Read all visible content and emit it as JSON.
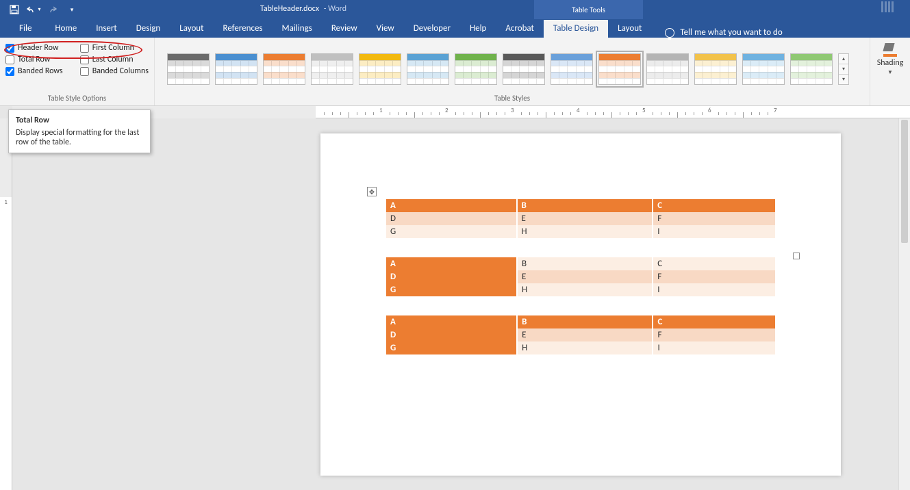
{
  "titlebar": {
    "doc_name": "TableHeader.docx",
    "app_suffix": "  -  Word",
    "table_tools_label": "Table Tools"
  },
  "tabs": {
    "file": "File",
    "home": "Home",
    "insert": "Insert",
    "design": "Design",
    "layout": "Layout",
    "references": "References",
    "mailings": "Mailings",
    "review": "Review",
    "view": "View",
    "developer": "Developer",
    "help": "Help",
    "acrobat": "Acrobat",
    "table_design": "Table Design",
    "table_layout": "Layout",
    "tell_me": "Tell me what you want to do"
  },
  "style_options": {
    "header_row": "Header Row",
    "total_row": "Total Row",
    "banded_rows": "Banded Rows",
    "first_column": "First Column",
    "last_column": "Last Column",
    "banded_columns": "Banded Columns",
    "group_label": "Table Style Options",
    "checked": {
      "header_row": true,
      "total_row": false,
      "banded_rows": true,
      "first_column": false,
      "last_column": false,
      "banded_columns": false
    }
  },
  "gallery": {
    "group_label": "Table Styles",
    "shading_label": "Shading",
    "palette": [
      "#6a6a6a",
      "#4a8fd0",
      "#ec7d31",
      "#c0c0c0",
      "#f2b90f",
      "#5aa2d4",
      "#6fb24b",
      "#595959",
      "#6aa0da",
      "#ec7d31",
      "#b4b4b4",
      "#f2c24a",
      "#6fb2e0",
      "#8fc873"
    ]
  },
  "tooltip": {
    "title": "Total Row",
    "body": "Display special formatting for the last row of the table."
  },
  "doc": {
    "tables": [
      {
        "rows": [
          [
            "A",
            "B",
            "C"
          ],
          [
            "D",
            "E",
            "F"
          ],
          [
            "G",
            "H",
            "I"
          ]
        ]
      },
      {
        "rows": [
          [
            "A",
            "B",
            "C"
          ],
          [
            "D",
            "E",
            "F"
          ],
          [
            "G",
            "H",
            "I"
          ]
        ]
      },
      {
        "rows": [
          [
            "A",
            "B",
            "C"
          ],
          [
            "D",
            "E",
            "F"
          ],
          [
            "G",
            "H",
            "I"
          ]
        ]
      }
    ]
  },
  "ruler": {
    "numbers": [
      "1",
      "2",
      "3",
      "4",
      "5",
      "6",
      "7"
    ]
  }
}
